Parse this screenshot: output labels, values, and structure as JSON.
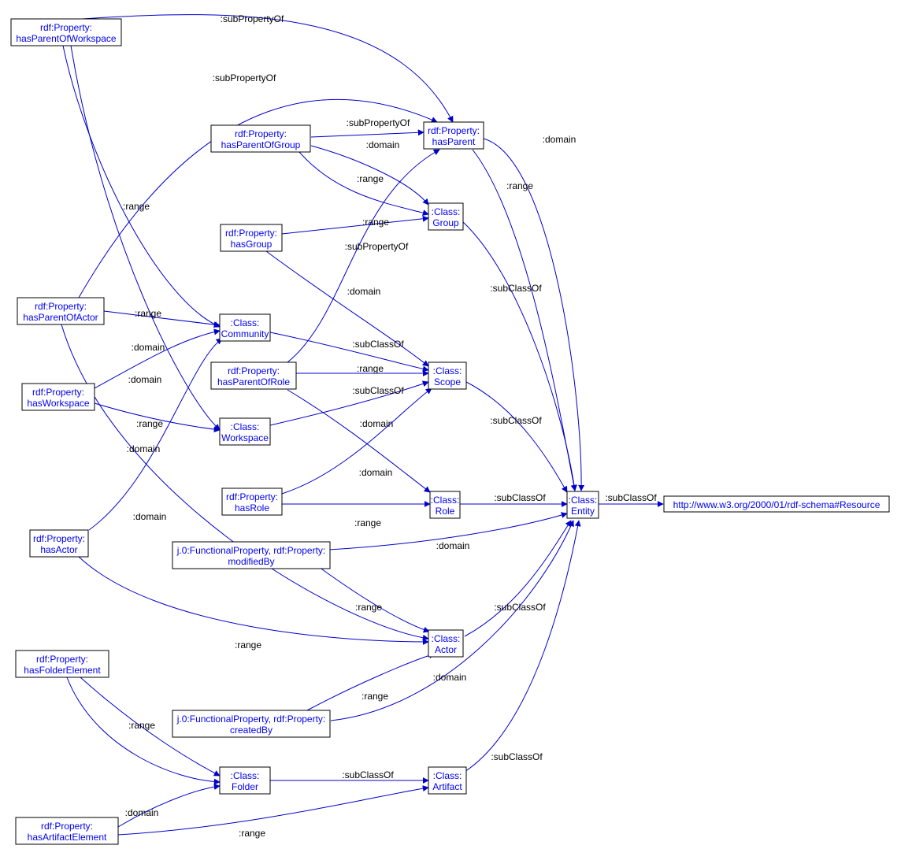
{
  "nodes": {
    "hasParentOfWorkspace": {
      "lines": [
        "rdf:Property:",
        "hasParentOfWorkspace"
      ]
    },
    "hasParentOfGroup": {
      "lines": [
        "rdf:Property:",
        "hasParentOfGroup"
      ]
    },
    "hasGroup": {
      "lines": [
        "rdf:Property:",
        "hasGroup"
      ]
    },
    "hasParentOfActor": {
      "lines": [
        "rdf:Property:",
        "hasParentOfActor"
      ]
    },
    "hasParentOfRole": {
      "lines": [
        "rdf:Property:",
        "hasParentOfRole"
      ]
    },
    "hasWorkspace": {
      "lines": [
        "rdf:Property:",
        "hasWorkspace"
      ]
    },
    "hasRole": {
      "lines": [
        "rdf:Property:",
        "hasRole"
      ]
    },
    "hasActor": {
      "lines": [
        "rdf:Property:",
        "hasActor"
      ]
    },
    "hasFolderElement": {
      "lines": [
        "rdf:Property:",
        "hasFolderElement"
      ]
    },
    "hasArtifactElement": {
      "lines": [
        "rdf:Property:",
        "hasArtifactElement"
      ]
    },
    "modifiedBy": {
      "lines": [
        "j.0:FunctionalProperty, rdf:Property:",
        "modifiedBy"
      ]
    },
    "createdBy": {
      "lines": [
        "j.0:FunctionalProperty, rdf:Property:",
        "createdBy"
      ]
    },
    "hasParent": {
      "lines": [
        "rdf:Property:",
        "hasParent"
      ]
    },
    "Group": {
      "lines": [
        ":Class:",
        "Group"
      ]
    },
    "Community": {
      "lines": [
        ":Class:",
        "Community"
      ]
    },
    "Scope": {
      "lines": [
        ":Class:",
        "Scope"
      ]
    },
    "Workspace": {
      "lines": [
        ":Class:",
        "Workspace"
      ]
    },
    "Role": {
      "lines": [
        ":Class:",
        "Role"
      ]
    },
    "Actor": {
      "lines": [
        ":Class:",
        "Actor"
      ]
    },
    "Folder": {
      "lines": [
        ":Class:",
        "Folder"
      ]
    },
    "Artifact": {
      "lines": [
        ":Class:",
        "Artifact"
      ]
    },
    "Entity": {
      "lines": [
        ":Class:",
        "Entity"
      ]
    },
    "Resource": {
      "lines": [
        "http://www.w3.org/2000/01/rdf-schema#Resource"
      ]
    }
  },
  "edge_labels": {
    "subPropertyOf": ":subPropertyOf",
    "domain": ":domain",
    "range": ":range",
    "subClassOf": ":subClassOf"
  },
  "chart_data": {
    "type": "graph",
    "title": "",
    "directed": true,
    "nodes": [
      "rdf:Property:hasParentOfWorkspace",
      "rdf:Property:hasParentOfGroup",
      "rdf:Property:hasGroup",
      "rdf:Property:hasParentOfActor",
      "rdf:Property:hasParentOfRole",
      "rdf:Property:hasWorkspace",
      "rdf:Property:hasRole",
      "rdf:Property:hasActor",
      "rdf:Property:hasFolderElement",
      "rdf:Property:hasArtifactElement",
      "j.0:FunctionalProperty,rdf:Property:modifiedBy",
      "j.0:FunctionalProperty,rdf:Property:createdBy",
      "rdf:Property:hasParent",
      ":Class:Group",
      ":Class:Community",
      ":Class:Scope",
      ":Class:Workspace",
      ":Class:Role",
      ":Class:Actor",
      ":Class:Folder",
      ":Class:Artifact",
      ":Class:Entity",
      "http://www.w3.org/2000/01/rdf-schema#Resource"
    ],
    "edges": [
      {
        "from": "rdf:Property:hasParentOfWorkspace",
        "to": "rdf:Property:hasParent",
        "label": ":subPropertyOf"
      },
      {
        "from": "rdf:Property:hasParentOfWorkspace",
        "to": ":Class:Workspace",
        "label": ":domain"
      },
      {
        "from": "rdf:Property:hasParentOfWorkspace",
        "to": ":Class:Community",
        "label": ":range"
      },
      {
        "from": "rdf:Property:hasParentOfGroup",
        "to": "rdf:Property:hasParent",
        "label": ":subPropertyOf"
      },
      {
        "from": "rdf:Property:hasParentOfGroup",
        "to": ":Class:Group",
        "label": ":domain"
      },
      {
        "from": "rdf:Property:hasParentOfGroup",
        "to": ":Class:Group",
        "label": ":range"
      },
      {
        "from": "rdf:Property:hasGroup",
        "to": ":Class:Scope",
        "label": ":domain"
      },
      {
        "from": "rdf:Property:hasGroup",
        "to": ":Class:Group",
        "label": ":range"
      },
      {
        "from": "rdf:Property:hasParentOfActor",
        "to": "rdf:Property:hasParent",
        "label": ":subPropertyOf"
      },
      {
        "from": "rdf:Property:hasParentOfActor",
        "to": ":Class:Actor",
        "label": ":domain"
      },
      {
        "from": "rdf:Property:hasParentOfActor",
        "to": ":Class:Community",
        "label": ":range"
      },
      {
        "from": "rdf:Property:hasParentOfRole",
        "to": "rdf:Property:hasParent",
        "label": ":subPropertyOf"
      },
      {
        "from": "rdf:Property:hasParentOfRole",
        "to": ":Class:Role",
        "label": ":domain"
      },
      {
        "from": "rdf:Property:hasParentOfRole",
        "to": ":Class:Scope",
        "label": ":range"
      },
      {
        "from": "rdf:Property:hasWorkspace",
        "to": ":Class:Community",
        "label": ":domain"
      },
      {
        "from": "rdf:Property:hasWorkspace",
        "to": ":Class:Workspace",
        "label": ":range"
      },
      {
        "from": "rdf:Property:hasRole",
        "to": ":Class:Scope",
        "label": ":domain"
      },
      {
        "from": "rdf:Property:hasRole",
        "to": ":Class:Role",
        "label": ":range"
      },
      {
        "from": "rdf:Property:hasActor",
        "to": ":Class:Community",
        "label": ":domain"
      },
      {
        "from": "rdf:Property:hasActor",
        "to": ":Class:Actor",
        "label": ":range"
      },
      {
        "from": "rdf:Property:hasFolderElement",
        "to": ":Class:Folder",
        "label": ":domain"
      },
      {
        "from": "rdf:Property:hasFolderElement",
        "to": ":Class:Folder",
        "label": ":range"
      },
      {
        "from": "rdf:Property:hasArtifactElement",
        "to": ":Class:Folder",
        "label": ":domain"
      },
      {
        "from": "rdf:Property:hasArtifactElement",
        "to": ":Class:Artifact",
        "label": ":range"
      },
      {
        "from": "j.0:FunctionalProperty,rdf:Property:modifiedBy",
        "to": ":Class:Entity",
        "label": ":domain"
      },
      {
        "from": "j.0:FunctionalProperty,rdf:Property:modifiedBy",
        "to": ":Class:Actor",
        "label": ":range"
      },
      {
        "from": "j.0:FunctionalProperty,rdf:Property:createdBy",
        "to": ":Class:Entity",
        "label": ":domain"
      },
      {
        "from": "j.0:FunctionalProperty,rdf:Property:createdBy",
        "to": ":Class:Actor",
        "label": ":range"
      },
      {
        "from": "rdf:Property:hasParent",
        "to": ":Class:Entity",
        "label": ":domain"
      },
      {
        "from": "rdf:Property:hasParent",
        "to": ":Class:Entity",
        "label": ":range"
      },
      {
        "from": ":Class:Group",
        "to": ":Class:Entity",
        "label": ":subClassOf"
      },
      {
        "from": ":Class:Community",
        "to": ":Class:Scope",
        "label": ":subClassOf"
      },
      {
        "from": ":Class:Workspace",
        "to": ":Class:Scope",
        "label": ":subClassOf"
      },
      {
        "from": ":Class:Scope",
        "to": ":Class:Entity",
        "label": ":subClassOf"
      },
      {
        "from": ":Class:Role",
        "to": ":Class:Entity",
        "label": ":subClassOf"
      },
      {
        "from": ":Class:Actor",
        "to": ":Class:Entity",
        "label": ":subClassOf"
      },
      {
        "from": ":Class:Folder",
        "to": ":Class:Artifact",
        "label": ":subClassOf"
      },
      {
        "from": ":Class:Artifact",
        "to": ":Class:Entity",
        "label": ":subClassOf"
      },
      {
        "from": ":Class:Entity",
        "to": "http://www.w3.org/2000/01/rdf-schema#Resource",
        "label": ":subClassOf"
      }
    ]
  }
}
